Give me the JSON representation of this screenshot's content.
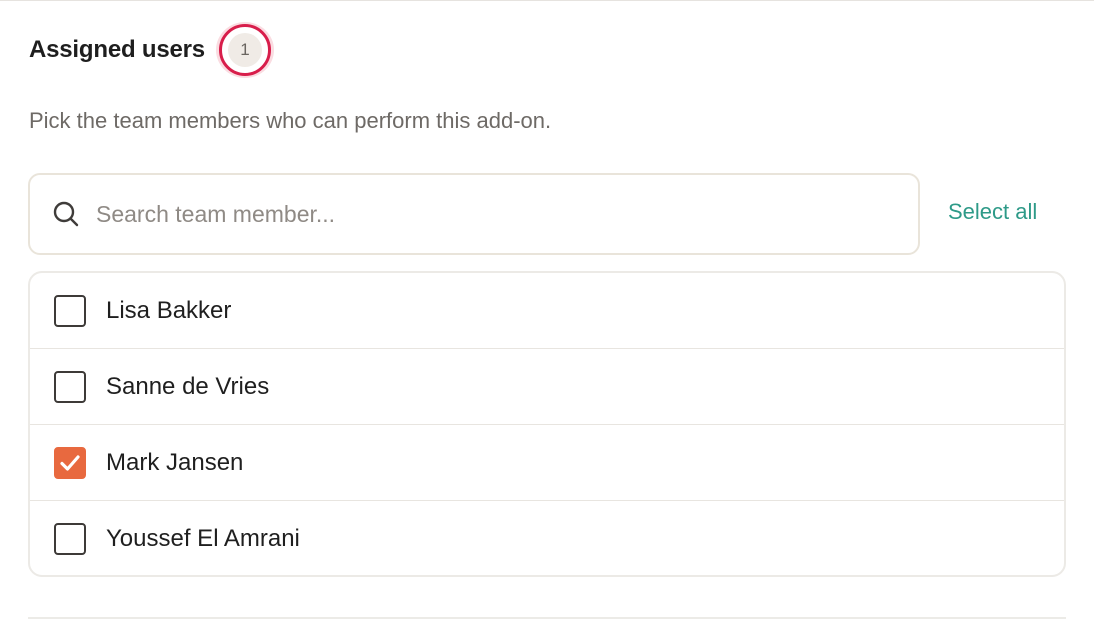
{
  "header": {
    "title": "Assigned users",
    "count_badge": "1"
  },
  "description": "Pick the team members who can perform this add-on.",
  "search": {
    "placeholder": "Search team member...",
    "value": "",
    "icon": "search-icon"
  },
  "select_all_label": "Select all",
  "members": [
    {
      "name": "Lisa Bakker",
      "checked": false
    },
    {
      "name": "Sanne de Vries",
      "checked": false
    },
    {
      "name": "Mark Jansen",
      "checked": true
    },
    {
      "name": "Youssef El Amrani",
      "checked": false
    }
  ],
  "colors": {
    "accent_link": "#2e9a88",
    "checkbox_checked": "#e8693f",
    "badge_ring": "#d81e4b",
    "badge_fill": "#f0ebe6"
  }
}
